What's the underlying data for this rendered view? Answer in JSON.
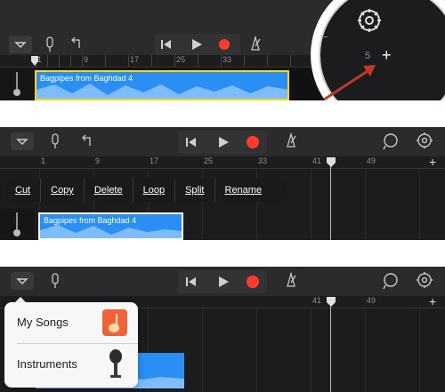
{
  "panel1": {
    "ruler_numbers": [
      "1",
      "9",
      "17",
      "25",
      "33"
    ],
    "region_name": "Bagpipes from Baghdad 4",
    "zoom_number": "5",
    "plus": "+",
    "minus": "−"
  },
  "panel2": {
    "ruler_numbers": [
      "1",
      "9",
      "17",
      "25",
      "33",
      "41",
      "49"
    ],
    "region_name": "Bagpipes from Baghdad 4",
    "context_menu": [
      "Cut",
      "Copy",
      "Delete",
      "Loop",
      "Split",
      "Rename"
    ],
    "plus": "+"
  },
  "panel3": {
    "ruler_numbers": [
      "41",
      "49"
    ],
    "plus": "+",
    "menu_items": [
      "My Songs",
      "Instruments"
    ]
  },
  "colors": {
    "accent_blue": "#2a8ef5",
    "record_red": "#ff3b30",
    "arrow_red": "#c0392b",
    "panel_bg": "#1c1c1e"
  },
  "icons": [
    "dropdown-icon",
    "microphone-icon",
    "undo-icon",
    "rewind-icon",
    "play-icon",
    "record-icon",
    "metronome-icon",
    "loop-icon",
    "settings-gear-icon",
    "guitar-icon",
    "microphone-instrument-icon"
  ]
}
